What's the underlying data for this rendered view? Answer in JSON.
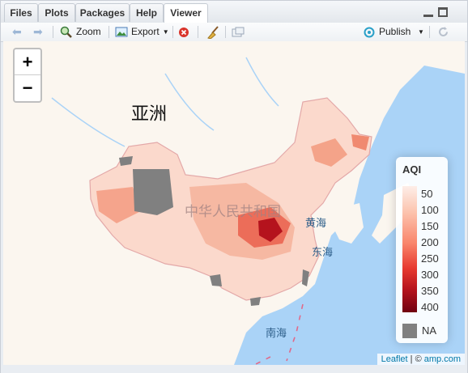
{
  "tabs": [
    {
      "label": "Files",
      "active": false
    },
    {
      "label": "Plots",
      "active": false
    },
    {
      "label": "Packages",
      "active": false
    },
    {
      "label": "Help",
      "active": false
    },
    {
      "label": "Viewer",
      "active": true
    }
  ],
  "toolbar": {
    "zoom_label": "Zoom",
    "export_label": "Export",
    "publish_label": "Publish"
  },
  "map": {
    "zoom_in": "+",
    "zoom_out": "−",
    "labels": {
      "asia": "亚洲",
      "china": "中华人民共和国",
      "yellow_sea": "黄海",
      "east_sea": "东海",
      "south_sea": "南海"
    },
    "legend": {
      "title": "AQI",
      "ticks": [
        "50",
        "100",
        "150",
        "200",
        "250",
        "300",
        "350",
        "400"
      ],
      "na_label": "NA"
    },
    "attribution": {
      "leaflet": "Leaflet",
      "sep": " | © ",
      "provider": "amp.com"
    },
    "colors": {
      "water": "#aad3f7",
      "land": "#fdf8f3",
      "na": "#808080",
      "high": "#b5131d"
    }
  }
}
